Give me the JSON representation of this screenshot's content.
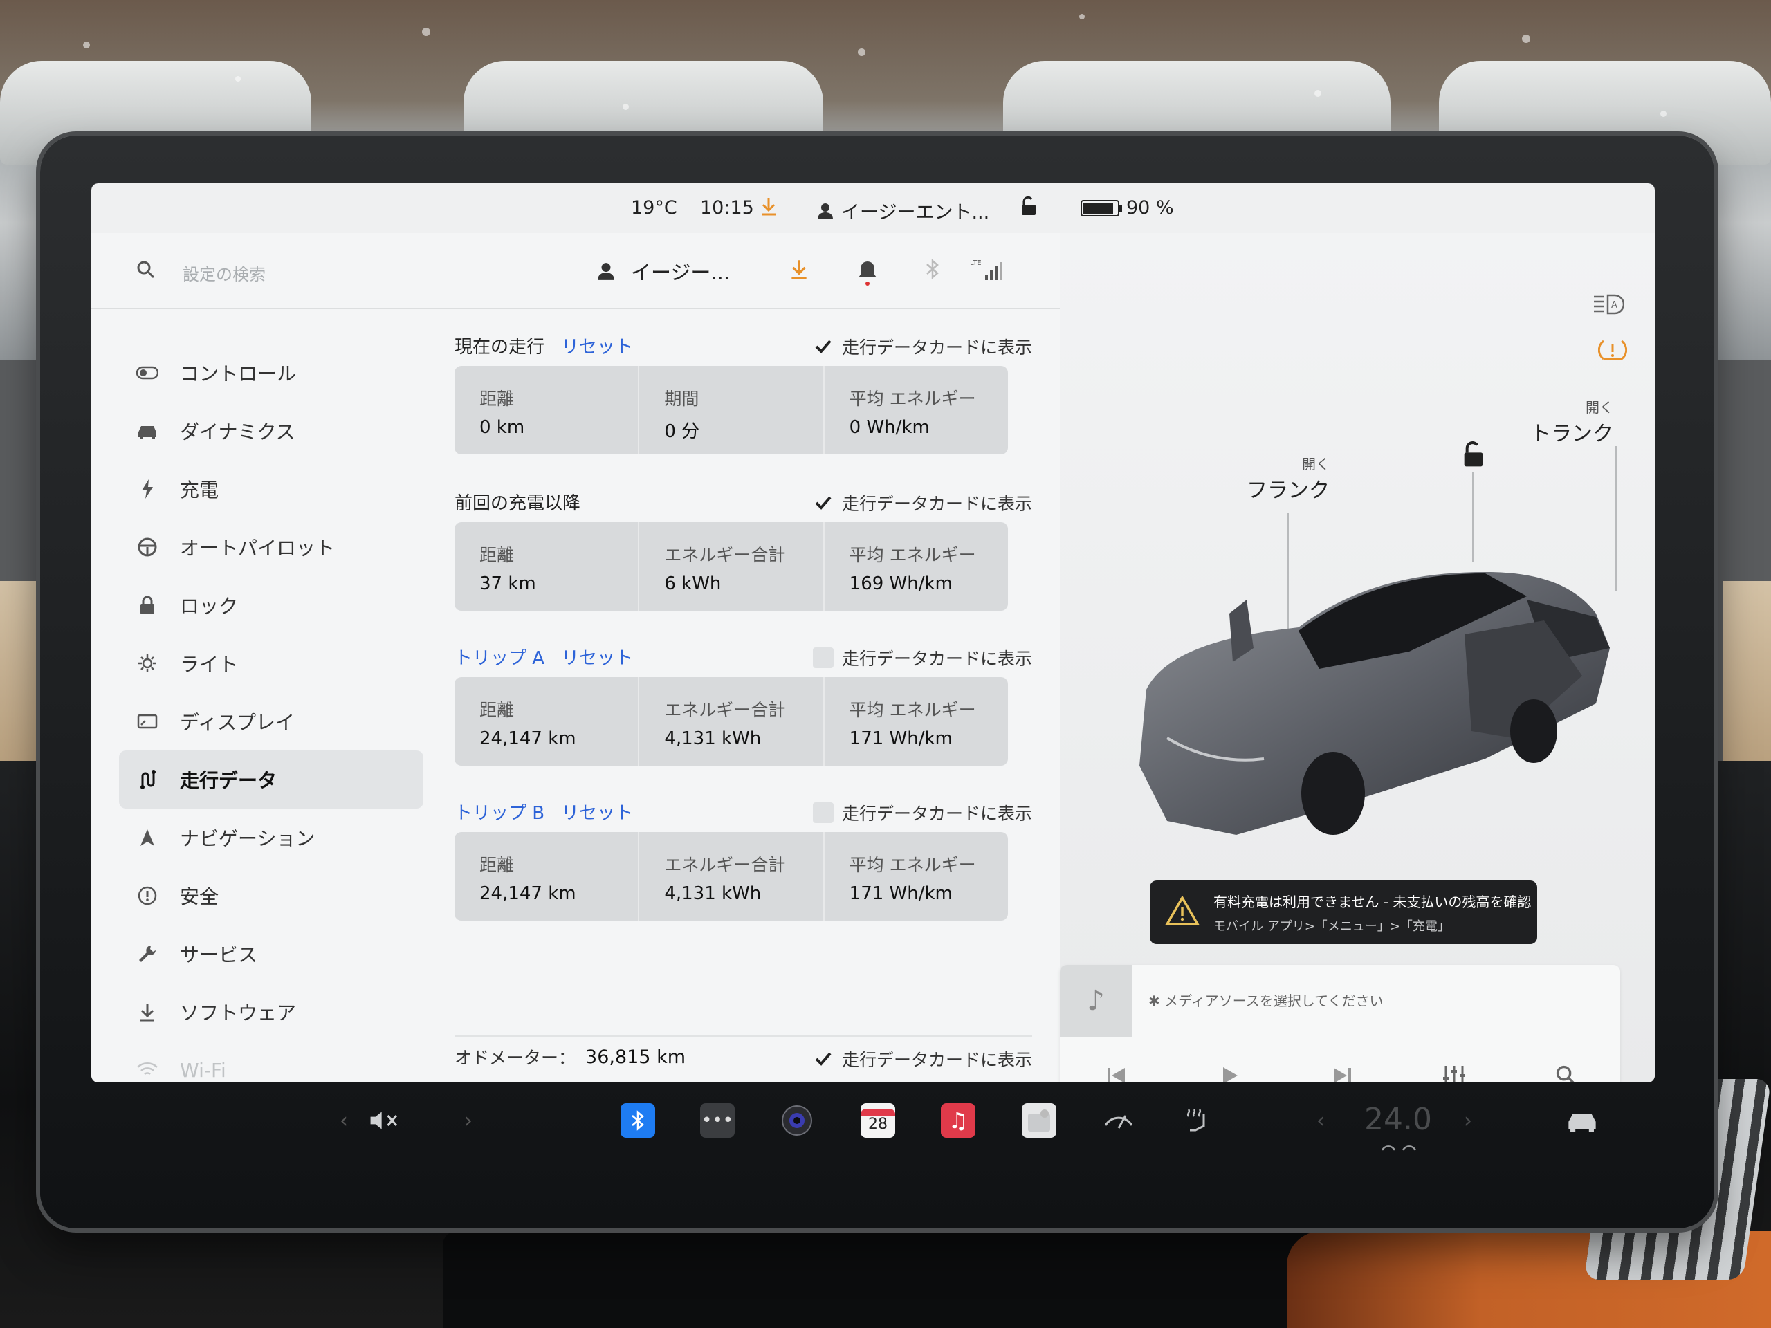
{
  "status_bar": {
    "temperature": "19°C",
    "time": "10:15",
    "profile": "イージーエント...",
    "battery": "90 %",
    "battery_level": 0.9
  },
  "settings_header": {
    "search_placeholder": "設定の検索",
    "profile_short": "イージー..."
  },
  "sidebar": {
    "items": [
      {
        "label": "コントロール",
        "icon": "toggle-icon"
      },
      {
        "label": "ダイナミクス",
        "icon": "car-icon"
      },
      {
        "label": "充電",
        "icon": "bolt-icon"
      },
      {
        "label": "オートパイロット",
        "icon": "steering-wheel-icon"
      },
      {
        "label": "ロック",
        "icon": "lock-icon"
      },
      {
        "label": "ライト",
        "icon": "sun-icon"
      },
      {
        "label": "ディスプレイ",
        "icon": "display-icon"
      },
      {
        "label": "走行データ",
        "icon": "trip-icon"
      },
      {
        "label": "ナビゲーション",
        "icon": "navigation-icon"
      },
      {
        "label": "安全",
        "icon": "safety-icon"
      },
      {
        "label": "サービス",
        "icon": "wrench-icon"
      },
      {
        "label": "ソフトウェア",
        "icon": "download-icon"
      },
      {
        "label": "Wi-Fi",
        "icon": "wifi-icon"
      }
    ],
    "active_index": 7
  },
  "trips": {
    "show_on_card_label": "走行データカードに表示",
    "current": {
      "title": "現在の走行",
      "reset": "リセット",
      "show_on_card": true,
      "cells": [
        {
          "label": "距離",
          "value": "0 km"
        },
        {
          "label": "期間",
          "value": "0 分"
        },
        {
          "label": "平均 エネルギー",
          "value": "0 Wh/km"
        }
      ]
    },
    "since_charge": {
      "title": "前回の充電以降",
      "show_on_card": true,
      "cells": [
        {
          "label": "距離",
          "value": "37 km"
        },
        {
          "label": "エネルギー合計",
          "value": "6 kWh"
        },
        {
          "label": "平均 エネルギー",
          "value": "169 Wh/km"
        }
      ]
    },
    "trip_a": {
      "title": "トリップ A",
      "reset": "リセット",
      "show_on_card": false,
      "cells": [
        {
          "label": "距離",
          "value": "24,147 km"
        },
        {
          "label": "エネルギー合計",
          "value": "4,131 kWh"
        },
        {
          "label": "平均 エネルギー",
          "value": "171 Wh/km"
        }
      ]
    },
    "trip_b": {
      "title": "トリップ B",
      "reset": "リセット",
      "show_on_card": false,
      "cells": [
        {
          "label": "距離",
          "value": "24,147 km"
        },
        {
          "label": "エネルギー合計",
          "value": "4,131 kWh"
        },
        {
          "label": "平均 エネルギー",
          "value": "171 Wh/km"
        }
      ]
    },
    "odometer": {
      "label": "オドメーター：",
      "value": "36,815 km",
      "show_on_card": true
    }
  },
  "car_panel": {
    "frunk_action": "開く",
    "frunk_label": "フランク",
    "trunk_action": "開く",
    "trunk_label": "トランク"
  },
  "alert": {
    "line1": "有料充電は利用できません - 未支払いの残高を確認",
    "line2": "モバイル アプリ>「メニュー」>「充電」"
  },
  "media": {
    "source_prompt": "メディアソースを選択してください"
  },
  "dock": {
    "calendar_day": "28",
    "cabin_temp": "24.0"
  },
  "colors": {
    "accent_blue": "#2d63d8",
    "download_orange": "#e8912a",
    "alert_bg": "#1f2022",
    "music_red": "#e03a4a",
    "bluetooth_blue": "#1e7cf2"
  }
}
